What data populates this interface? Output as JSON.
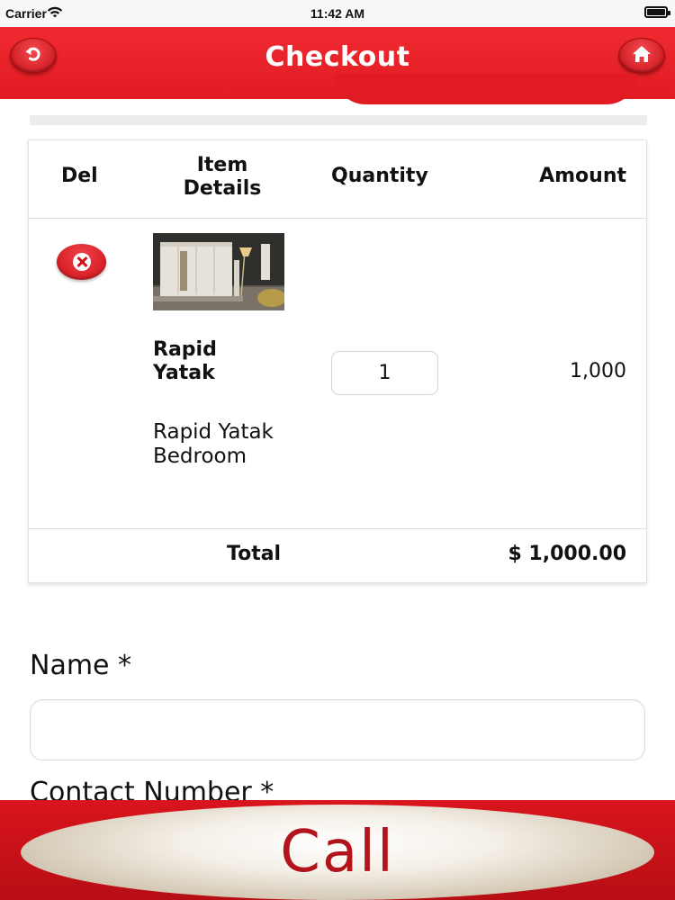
{
  "status_bar": {
    "carrier": "Carrier",
    "time": "11:42 AM"
  },
  "header": {
    "title": "Checkout",
    "back_icon": "undo-arrow-icon",
    "home_icon": "home-icon",
    "accent_color": "#e11b22"
  },
  "cart": {
    "columns": {
      "del": "Del",
      "item": "Item Details",
      "quantity": "Quantity",
      "amount": "Amount"
    },
    "items": [
      {
        "name": "Rapid Yatak",
        "description": "Rapid Yatak Bedroom",
        "quantity": "1",
        "amount": "1,000",
        "delete_icon": "close-circle-icon"
      }
    ],
    "total_label": "Total",
    "total_value": "$ 1,000.00"
  },
  "form": {
    "name_label": "Name *",
    "name_value": "",
    "contact_label": "Contact Number *"
  },
  "call": {
    "label": "Call"
  }
}
